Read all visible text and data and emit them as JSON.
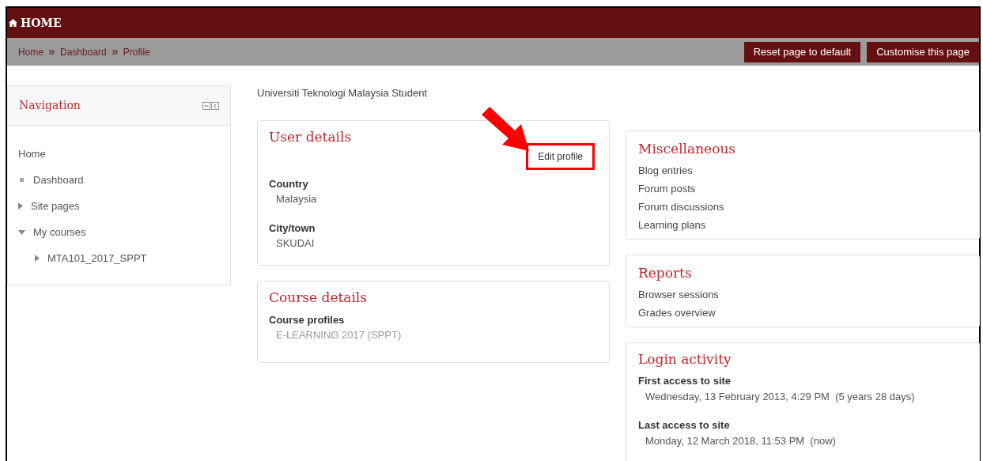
{
  "header": {
    "title": "HOME"
  },
  "breadcrumb": [
    "Home",
    "Dashboard",
    "Profile"
  ],
  "page_buttons": [
    "Reset page to default",
    "Customise this page"
  ],
  "navigation": {
    "title": "Navigation",
    "items": [
      {
        "label": "Home",
        "kind": "plain"
      },
      {
        "label": "Dashboard",
        "kind": "leaf"
      },
      {
        "label": "Site pages",
        "kind": "branch",
        "expanded": false
      },
      {
        "label": "My courses",
        "kind": "branch",
        "expanded": true,
        "children": [
          {
            "label": "MTA101_2017_SPPT",
            "kind": "branch",
            "expanded": false
          }
        ]
      }
    ]
  },
  "profile": {
    "subtitle": "Universiti Teknologi Malaysia Student"
  },
  "user_details": {
    "title": "User details",
    "edit_link": "Edit profile",
    "fields": [
      {
        "label": "Country",
        "value": "Malaysia"
      },
      {
        "label": "City/town",
        "value": "SKUDAI"
      }
    ]
  },
  "course_details": {
    "title": "Course details",
    "fields": [
      {
        "label": "Course profiles",
        "value": "E-LEARNING 2017 (SPPT)"
      }
    ]
  },
  "miscellaneous": {
    "title": "Miscellaneous",
    "links": [
      "Blog entries",
      "Forum posts",
      "Forum discussions",
      "Learning plans"
    ]
  },
  "reports": {
    "title": "Reports",
    "links": [
      "Browser sessions",
      "Grades overview"
    ]
  },
  "login_activity": {
    "title": "Login activity",
    "fields": [
      {
        "label": "First access to site",
        "value": "Wednesday, 13 February 2013, 4:29 PM  (5 years 28 days)"
      },
      {
        "label": "Last access to site",
        "value": "Monday, 12 March 2018, 11:53 PM  (now)"
      }
    ]
  }
}
